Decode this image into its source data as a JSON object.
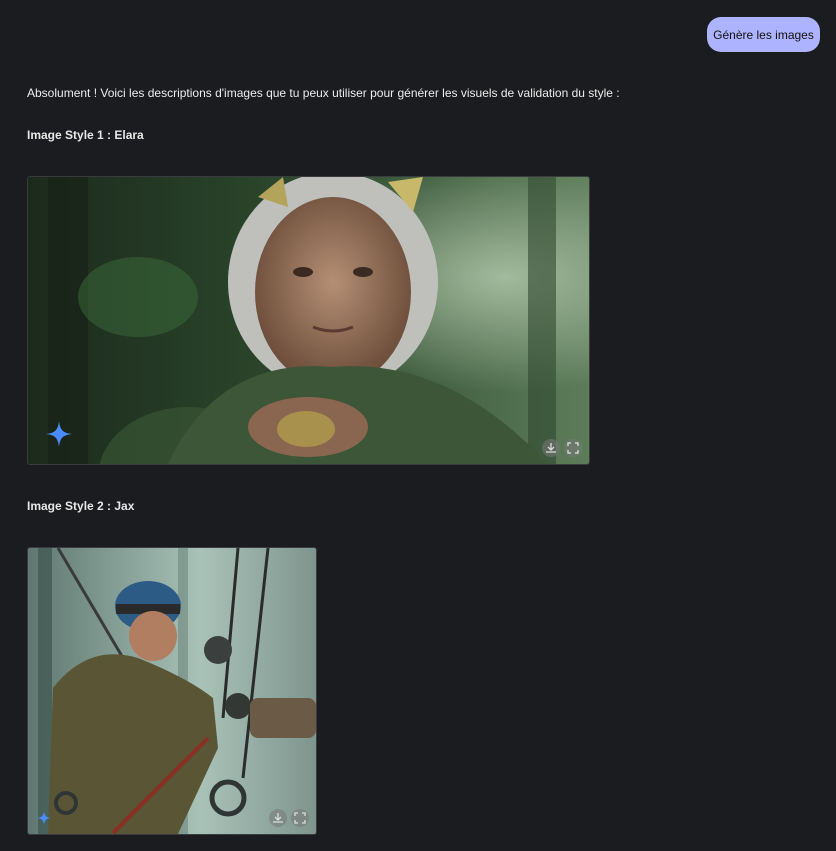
{
  "user_message": "Génère les images",
  "response": {
    "intro": "Absolument ! Voici les descriptions d'images que tu peux utiliser pour générer les visuels de validation du style :",
    "images": [
      {
        "heading": "Image Style 1 : Elara"
      },
      {
        "heading": "Image Style 2 : Jax"
      }
    ]
  },
  "icons": {
    "download": "download-icon",
    "fullscreen": "fullscreen-icon",
    "sparkle": "sparkle-icon"
  },
  "colors": {
    "background": "#1b1c1f",
    "user_bubble": "#aeb3ff",
    "sparkle": "#4a8cff"
  }
}
